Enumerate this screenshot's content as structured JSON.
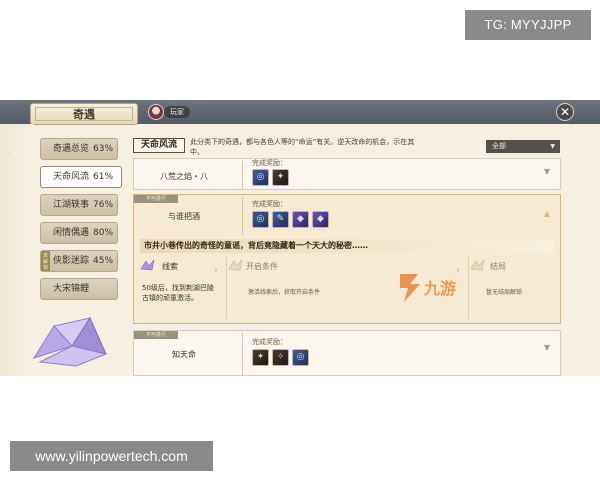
{
  "watermarks": {
    "top": "TG: MYYJJPP",
    "bottom": "www.yilinpowertech.com"
  },
  "header": {
    "title": "奇遇",
    "avatar_label": "玩家",
    "close_glyph": "✕"
  },
  "sidebar": {
    "items": [
      {
        "label": "奇遇总览",
        "pct": "63%",
        "active": false
      },
      {
        "label": "天命风流",
        "pct": "61%",
        "active": true
      },
      {
        "label": "江湖轶事",
        "pct": "76%",
        "active": false
      },
      {
        "label": "闲情偶遇",
        "pct": "80%",
        "active": false
      },
      {
        "label": "侠影迷踪",
        "pct": "45%",
        "active": false,
        "tag": "未解锁"
      },
      {
        "label": "大宋锦鲤",
        "pct": "",
        "active": false
      }
    ]
  },
  "main": {
    "tab_label": "天命风流",
    "description": "此分类下的奇遇，都与各色人等的“命运”有关。逆天改命的机会，示在其中。",
    "filter": {
      "value": "全部",
      "caret": "▼"
    },
    "cards": [
      {
        "name": "八荒之焰・八",
        "reward_label": "完成奖励：",
        "badge": "",
        "chevron": "▼"
      },
      {
        "name": "与谁把酒",
        "badge": "不可进行",
        "reward_label": "完成奖励：",
        "chevron": "▲",
        "banner": "市井小巷传出的奇怪的童谣，背后竟隐藏着一个天大的秘密……",
        "stages": [
          {
            "title": "线索",
            "text": "50级后，找到荆湖巴陵古镇的顽童激活。"
          },
          {
            "title": "开启条件",
            "note": "激活线索后，获取开启条件"
          },
          {
            "title": "结局",
            "note": "暂无结局解锁"
          }
        ]
      },
      {
        "name": "知天命",
        "badge": "不可进行",
        "reward_label": "完成奖励：",
        "chevron": "▼"
      }
    ]
  },
  "colors": {
    "accent": "#d9b57a",
    "panel": "#f6efe2",
    "topbar": "#5f6572"
  }
}
